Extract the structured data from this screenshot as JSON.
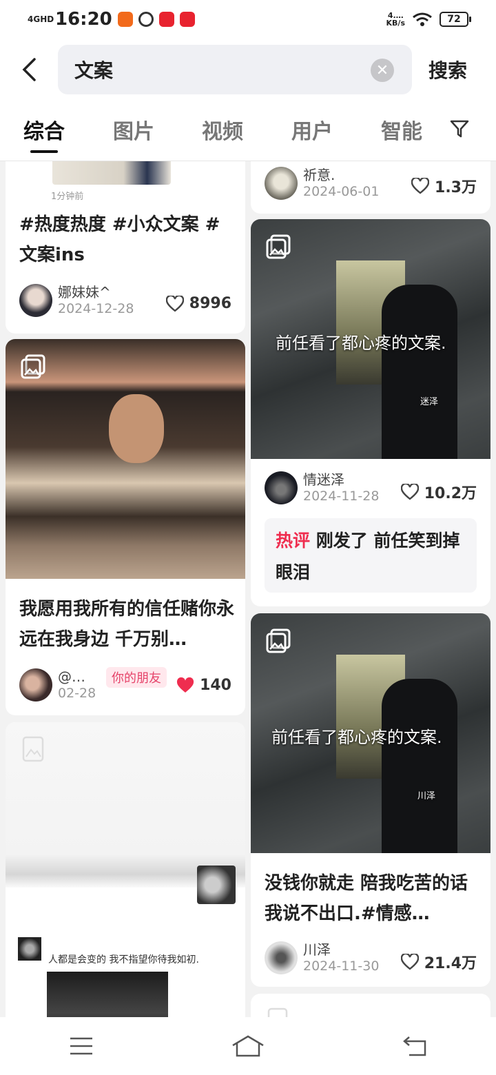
{
  "status_bar": {
    "network": "4GHD",
    "time": "16:20",
    "speed_value": "4.…",
    "speed_unit": "KB/s",
    "battery": "72"
  },
  "search": {
    "query": "文案",
    "button": "搜索"
  },
  "tabs": [
    "综合",
    "图片",
    "视频",
    "用户",
    "智能"
  ],
  "feed": {
    "left": [
      {
        "time_ago": "1分钟前",
        "title": "#热度热度 #小众文案 #文案ins",
        "user": "娜妹妹^",
        "date": "2024-12-28",
        "likes": "8996"
      },
      {
        "title": "我愿用我所有的信任赌你永远在我身边 千万别…",
        "user": "@…",
        "date": "02-28",
        "friend_badge": "你的朋友",
        "likes": "140"
      },
      {
        "caption": "人都是会变的 我不指望你待我如初."
      }
    ],
    "right": [
      {
        "user": "祈意.",
        "date": "2024-06-01",
        "likes": "1.3万"
      },
      {
        "overlay": "前任看了都心疼的文案.",
        "watermark": "迷泽",
        "user": "情迷泽",
        "date": "2024-11-28",
        "likes": "10.2万",
        "comment_tag": "热评",
        "comment": "刚发了 前任笑到掉眼泪"
      },
      {
        "overlay": "前任看了都心疼的文案.",
        "watermark": "川泽",
        "title": "没钱你就走 陪我吃苦的话 我说不出口.#情感…",
        "user": "川泽",
        "date": "2024-11-30",
        "likes": "21.4万"
      }
    ]
  },
  "colors": {
    "accent_red": "#ef2d4f",
    "friend_badge_bg": "#ffe8ed",
    "friend_badge_text": "#e6456b"
  },
  "icons": [
    "back-icon",
    "clear-icon",
    "filter-icon",
    "image-badge-icon",
    "heart-icon",
    "heart-filled-icon",
    "menu-icon",
    "home-icon",
    "return-icon"
  ]
}
